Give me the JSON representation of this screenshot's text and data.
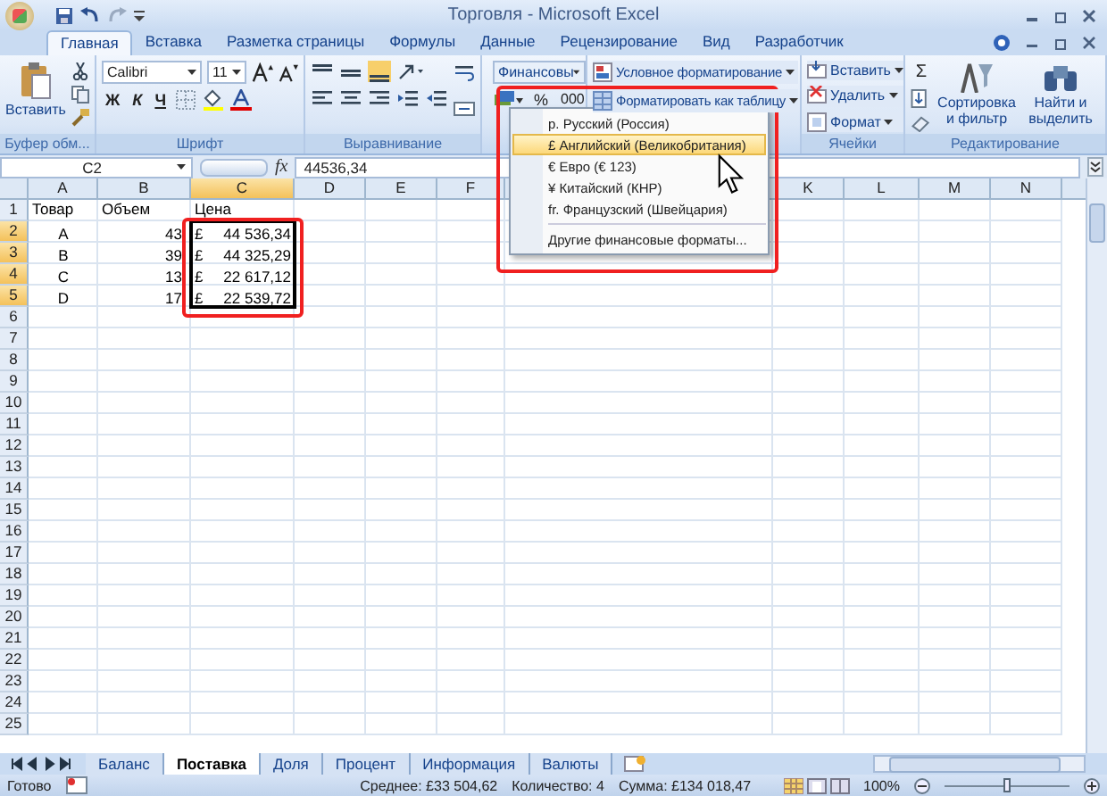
{
  "window": {
    "title": "Торговля - Microsoft Excel"
  },
  "tabs": [
    {
      "label": "Главная",
      "selected": true
    },
    {
      "label": "Вставка",
      "selected": false
    },
    {
      "label": "Разметка страницы",
      "selected": false
    },
    {
      "label": "Формулы",
      "selected": false
    },
    {
      "label": "Данные",
      "selected": false
    },
    {
      "label": "Рецензирование",
      "selected": false
    },
    {
      "label": "Вид",
      "selected": false
    },
    {
      "label": "Разработчик",
      "selected": false
    }
  ],
  "ribbon": {
    "clipboard": {
      "paste": "Вставить",
      "label": "Буфер обм..."
    },
    "font": {
      "family": "Calibri",
      "size": "11",
      "bold": "Ж",
      "italic": "К",
      "underline": "Ч",
      "label": "Шрифт"
    },
    "alignment": {
      "label": "Выравнивание"
    },
    "number": {
      "format": "Финансовы",
      "percent": "%",
      "thousands": "000"
    },
    "styles": {
      "conditional": "Условное форматирование",
      "as_table": "Форматировать как таблицу"
    },
    "cells": {
      "insert": "Вставить",
      "delete": "Удалить",
      "format": "Формат",
      "label": "Ячейки"
    },
    "editing": {
      "sum": "Σ",
      "sort": "Сортировка и фильтр",
      "find": "Найти и выделить",
      "label": "Редактирование"
    }
  },
  "formula_bar": {
    "name_box": "C2",
    "fx": "fx",
    "value": "44536,34"
  },
  "currency_menu": {
    "items": [
      {
        "label": "р. Русский (Россия)",
        "selected": false
      },
      {
        "label": "£ Английский (Великобритания)",
        "selected": true
      },
      {
        "label": "€ Евро (€ 123)",
        "selected": false
      },
      {
        "label": "¥ Китайский (КНР)",
        "selected": false
      },
      {
        "label": "fr. Французский (Швейцария)",
        "selected": false
      }
    ],
    "more": "Другие финансовые форматы..."
  },
  "columns": [
    {
      "label": "A",
      "selected": false
    },
    {
      "label": "B",
      "selected": false
    },
    {
      "label": "C",
      "selected": true
    },
    {
      "label": "D",
      "selected": false
    },
    {
      "label": "E",
      "selected": false
    },
    {
      "label": "F",
      "selected": false
    },
    {
      "label": "K",
      "selected": false
    },
    {
      "label": "L",
      "selected": false
    },
    {
      "label": "M",
      "selected": false
    },
    {
      "label": "N",
      "selected": false
    }
  ],
  "rows": [
    {
      "header": "1",
      "selected": false,
      "kind": "titles",
      "product": "Товар",
      "volume": "Объем",
      "price": "Цена"
    },
    {
      "header": "2",
      "selected": true,
      "kind": "data",
      "product": "A",
      "volume": "43",
      "currency": "£",
      "price": "44 536,34"
    },
    {
      "header": "3",
      "selected": true,
      "kind": "data",
      "product": "B",
      "volume": "39",
      "currency": "£",
      "price": "44 325,29"
    },
    {
      "header": "4",
      "selected": true,
      "kind": "data",
      "product": "C",
      "volume": "13",
      "currency": "£",
      "price": "22 617,12"
    },
    {
      "header": "5",
      "selected": true,
      "kind": "data",
      "product": "D",
      "volume": "17",
      "currency": "£",
      "price": "22 539,72"
    },
    {
      "header": "6",
      "selected": false
    },
    {
      "header": "7",
      "selected": false
    },
    {
      "header": "8",
      "selected": false
    },
    {
      "header": "9",
      "selected": false
    },
    {
      "header": "10",
      "selected": false
    },
    {
      "header": "11",
      "selected": false
    },
    {
      "header": "12",
      "selected": false
    },
    {
      "header": "13",
      "selected": false
    },
    {
      "header": "14",
      "selected": false
    },
    {
      "header": "15",
      "selected": false
    },
    {
      "header": "16",
      "selected": false
    },
    {
      "header": "17",
      "selected": false
    },
    {
      "header": "18",
      "selected": false
    },
    {
      "header": "19",
      "selected": false
    },
    {
      "header": "20",
      "selected": false
    },
    {
      "header": "21",
      "selected": false
    },
    {
      "header": "22",
      "selected": false
    },
    {
      "header": "23",
      "selected": false
    },
    {
      "header": "24",
      "selected": false
    },
    {
      "header": "25",
      "selected": false
    }
  ],
  "sheet_tabs": [
    {
      "label": "Баланс",
      "selected": false
    },
    {
      "label": "Поставка",
      "selected": true
    },
    {
      "label": "Доля",
      "selected": false
    },
    {
      "label": "Процент",
      "selected": false
    },
    {
      "label": "Информация",
      "selected": false
    },
    {
      "label": "Валюты",
      "selected": false
    }
  ],
  "status_bar": {
    "ready": "Готово",
    "average": "Среднее: £33 504,62",
    "count": "Количество: 4",
    "sum": "Сумма: £134 018,47",
    "zoom": "100%",
    "zoom_slider": {
      "level": 0.5
    }
  }
}
